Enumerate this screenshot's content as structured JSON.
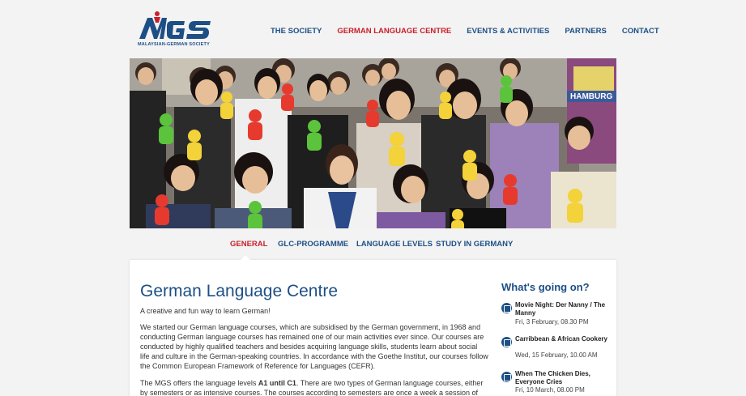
{
  "logo": {
    "text": "MGS",
    "subtitle": "MALAYSIAN-GERMAN SOCIETY",
    "colors": {
      "blue": "#1d4f86",
      "red": "#c8202b"
    }
  },
  "nav": {
    "items": [
      {
        "label": "THE SOCIETY",
        "active": false
      },
      {
        "label": "GERMAN LANGUAGE CENTRE",
        "active": true
      },
      {
        "label": "EVENTS & ACTIVITIES",
        "active": false
      },
      {
        "label": "PARTNERS",
        "active": false
      },
      {
        "label": "CONTACT",
        "active": false
      }
    ]
  },
  "hero": {
    "sign_text": "HAMBURG"
  },
  "subnav": {
    "items": [
      {
        "label": "GENERAL",
        "active": true
      },
      {
        "label": "GLC-PROGRAMME",
        "active": false
      },
      {
        "label": "LANGUAGE LEVELS",
        "active": false
      },
      {
        "label": "STUDY IN GERMANY",
        "active": false
      }
    ]
  },
  "main": {
    "title": "German Language Centre",
    "lead": "A creative and fun way to learn German!",
    "para1": "We started our German language courses, which are subsidised by the German government, in 1968 and conducting German language courses has remained one of our main activities ever since. Our courses are conducted by highly qualified teachers and besides acquiring language skills, students learn about social life and culture in the German-speaking countries. In accordance with the Goethe Institut, our courses follow the Common European Framework of Reference for Languages (CEFR).",
    "para2_a": "The MGS offers the language levels ",
    "para2_b": "A1 until C1",
    "para2_c": ". There are two types of German language courses, either by semesters or as intensive courses. The courses according to semesters are once a week a session of"
  },
  "sidebar": {
    "title": "What's going on?",
    "events": [
      {
        "icon": "calendar-icon",
        "title": "Movie Night: Der Nanny / The Manny",
        "date": "Fri, 3 February, 08.30 PM"
      },
      {
        "icon": "calendar-icon",
        "title": "Carribbean & African Cookery",
        "date": "Wed, 15 February, 10.00 AM"
      },
      {
        "icon": "calendar-icon",
        "title": "When The Chicken Dies, Everyone Cries",
        "date": "Fri, 10 March, 08.00 PM"
      }
    ]
  }
}
